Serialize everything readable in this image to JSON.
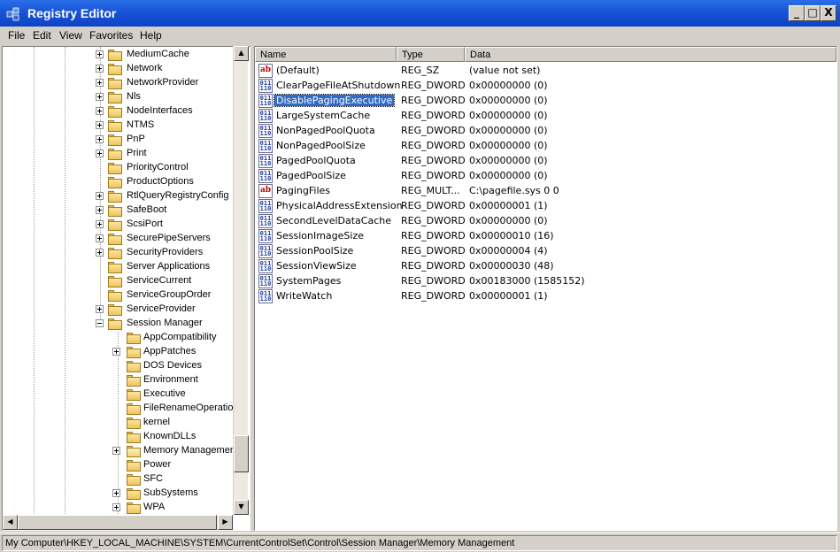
{
  "window": {
    "title": "Registry Editor",
    "minimize_glyph": "_",
    "maximize_glyph": "□",
    "close_glyph": "X"
  },
  "menu": [
    "File",
    "Edit",
    "View",
    "Favorites",
    "Help"
  ],
  "tree": {
    "nodes": [
      {
        "label": "MediumCache",
        "expander": "plus",
        "level": 1
      },
      {
        "label": "Network",
        "expander": "plus",
        "level": 1
      },
      {
        "label": "NetworkProvider",
        "expander": "plus",
        "level": 1
      },
      {
        "label": "Nls",
        "expander": "plus",
        "level": 1
      },
      {
        "label": "NodeInterfaces",
        "expander": "plus",
        "level": 1
      },
      {
        "label": "NTMS",
        "expander": "plus",
        "level": 1
      },
      {
        "label": "PnP",
        "expander": "plus",
        "level": 1
      },
      {
        "label": "Print",
        "expander": "plus",
        "level": 1
      },
      {
        "label": "PriorityControl",
        "expander": "none",
        "level": 1
      },
      {
        "label": "ProductOptions",
        "expander": "none",
        "level": 1
      },
      {
        "label": "RtlQueryRegistryConfig",
        "expander": "plus",
        "level": 1
      },
      {
        "label": "SafeBoot",
        "expander": "plus",
        "level": 1
      },
      {
        "label": "ScsiPort",
        "expander": "plus",
        "level": 1
      },
      {
        "label": "SecurePipeServers",
        "expander": "plus",
        "level": 1
      },
      {
        "label": "SecurityProviders",
        "expander": "plus",
        "level": 1
      },
      {
        "label": "Server Applications",
        "expander": "none",
        "level": 1
      },
      {
        "label": "ServiceCurrent",
        "expander": "none",
        "level": 1
      },
      {
        "label": "ServiceGroupOrder",
        "expander": "none",
        "level": 1
      },
      {
        "label": "ServiceProvider",
        "expander": "plus",
        "level": 1
      },
      {
        "label": "Session Manager",
        "expander": "minus",
        "level": 1
      },
      {
        "label": "AppCompatibility",
        "expander": "none",
        "level": 2
      },
      {
        "label": "AppPatches",
        "expander": "plus",
        "level": 2
      },
      {
        "label": "DOS Devices",
        "expander": "none",
        "level": 2
      },
      {
        "label": "Environment",
        "expander": "none",
        "level": 2
      },
      {
        "label": "Executive",
        "expander": "none",
        "level": 2
      },
      {
        "label": "FileRenameOperations",
        "expander": "none",
        "level": 2
      },
      {
        "label": "kernel",
        "expander": "none",
        "level": 2
      },
      {
        "label": "KnownDLLs",
        "expander": "none",
        "level": 2
      },
      {
        "label": "Memory Management",
        "expander": "plus",
        "level": 2,
        "open": true
      },
      {
        "label": "Power",
        "expander": "none",
        "level": 2
      },
      {
        "label": "SFC",
        "expander": "none",
        "level": 2
      },
      {
        "label": "SubSystems",
        "expander": "plus",
        "level": 2
      },
      {
        "label": "WPA",
        "expander": "plus",
        "level": 2
      }
    ]
  },
  "list": {
    "columns": [
      "Name",
      "Type",
      "Data"
    ],
    "rows": [
      {
        "name": "(Default)",
        "type": "REG_SZ",
        "data": "(value not set)",
        "icon": "string-value-icon"
      },
      {
        "name": "ClearPageFileAtShutdown",
        "type": "REG_DWORD",
        "data": "0x00000000 (0)",
        "icon": "binary-value-icon"
      },
      {
        "name": "DisablePagingExecutive",
        "type": "REG_DWORD",
        "data": "0x00000000 (0)",
        "icon": "binary-value-icon",
        "selected": true
      },
      {
        "name": "LargeSystemCache",
        "type": "REG_DWORD",
        "data": "0x00000000 (0)",
        "icon": "binary-value-icon"
      },
      {
        "name": "NonPagedPoolQuota",
        "type": "REG_DWORD",
        "data": "0x00000000 (0)",
        "icon": "binary-value-icon"
      },
      {
        "name": "NonPagedPoolSize",
        "type": "REG_DWORD",
        "data": "0x00000000 (0)",
        "icon": "binary-value-icon"
      },
      {
        "name": "PagedPoolQuota",
        "type": "REG_DWORD",
        "data": "0x00000000 (0)",
        "icon": "binary-value-icon"
      },
      {
        "name": "PagedPoolSize",
        "type": "REG_DWORD",
        "data": "0x00000000 (0)",
        "icon": "binary-value-icon"
      },
      {
        "name": "PagingFiles",
        "type": "REG_MULT...",
        "data": "C:\\pagefile.sys 0 0",
        "icon": "string-value-icon"
      },
      {
        "name": "PhysicalAddressExtension",
        "type": "REG_DWORD",
        "data": "0x00000001 (1)",
        "icon": "binary-value-icon"
      },
      {
        "name": "SecondLevelDataCache",
        "type": "REG_DWORD",
        "data": "0x00000000 (0)",
        "icon": "binary-value-icon"
      },
      {
        "name": "SessionImageSize",
        "type": "REG_DWORD",
        "data": "0x00000010 (16)",
        "icon": "binary-value-icon"
      },
      {
        "name": "SessionPoolSize",
        "type": "REG_DWORD",
        "data": "0x00000004 (4)",
        "icon": "binary-value-icon"
      },
      {
        "name": "SessionViewSize",
        "type": "REG_DWORD",
        "data": "0x00000030 (48)",
        "icon": "binary-value-icon"
      },
      {
        "name": "SystemPages",
        "type": "REG_DWORD",
        "data": "0x00183000 (1585152)",
        "icon": "binary-value-icon"
      },
      {
        "name": "WriteWatch",
        "type": "REG_DWORD",
        "data": "0x00000001 (1)",
        "icon": "binary-value-icon"
      }
    ]
  },
  "icons": {
    "string_glyph": "ab",
    "binary_glyph": "011\n110"
  },
  "scrollbar_glyphs": {
    "up": "▲",
    "down": "▼",
    "left": "◀",
    "right": "▶"
  },
  "status": {
    "path": "My Computer\\HKEY_LOCAL_MACHINE\\SYSTEM\\CurrentControlSet\\Control\\Session Manager\\Memory Management"
  },
  "colors": {
    "titlebar": "#0c44c4",
    "selection": "#316ac5"
  }
}
